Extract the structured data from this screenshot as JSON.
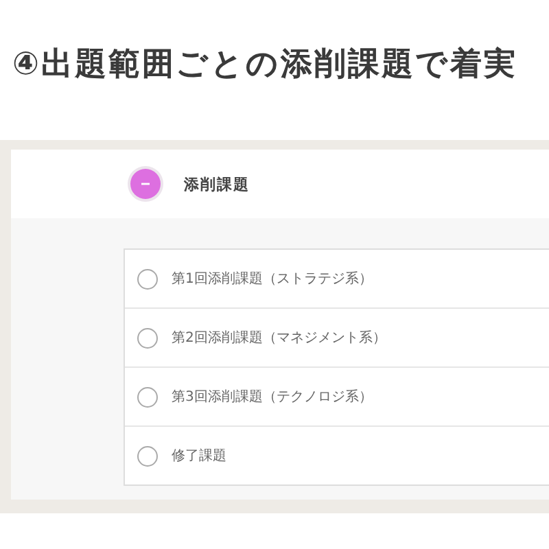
{
  "heading": "④出題範囲ごとの添削課題で着実",
  "section": {
    "title": "添削課題"
  },
  "tasks": [
    {
      "label": "第1回添削課題（ストラテジ系）",
      "checked": false
    },
    {
      "label": "第2回添削課題（マネジメント系）",
      "checked": false
    },
    {
      "label": "第3回添削課題（テクノロジ系）",
      "checked": false
    },
    {
      "label": "修了課題",
      "checked": false
    }
  ]
}
